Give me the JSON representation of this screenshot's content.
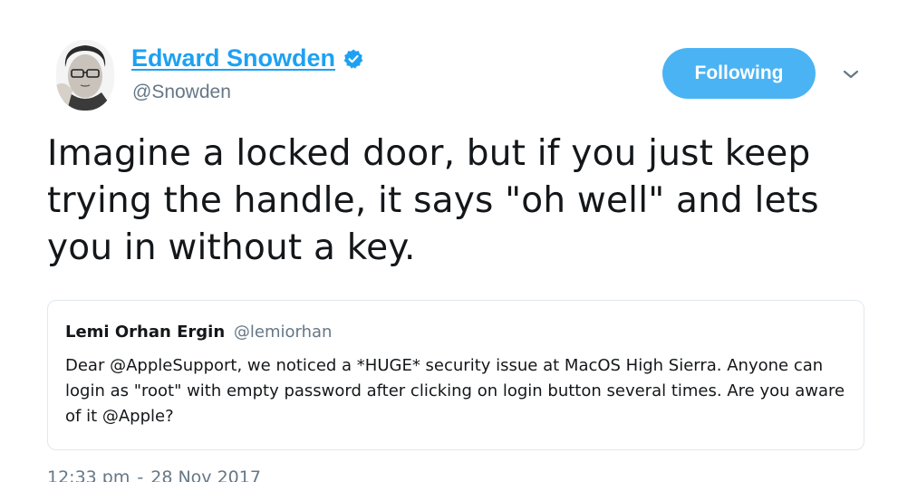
{
  "author": {
    "name": "Edward Snowden",
    "handle": "@Snowden",
    "verified": true,
    "avatar": "avatar-photo"
  },
  "follow_button": {
    "label": "Following",
    "color": "#4ab3f4"
  },
  "menu_icon": "chevron-down-icon",
  "tweet": {
    "text": "Imagine a locked door, but if you just keep trying the handle, it says \"oh well\" and lets you in without a key."
  },
  "quoted_tweet": {
    "name": "Lemi Orhan Ergin",
    "handle": "@lemiorhan",
    "text": "Dear @AppleSupport, we noticed a *HUGE* security issue at MacOS High Sierra. Anyone can login as \"root\" with empty password after clicking on login button several times. Are you aware of it @Apple?"
  },
  "timestamp": {
    "time": "12:33 pm",
    "separator": "-",
    "date": "28 Nov 2017"
  },
  "colors": {
    "accent": "#1da1f2",
    "text": "#14171a",
    "muted": "#657786",
    "border": "#e1e8ed"
  }
}
